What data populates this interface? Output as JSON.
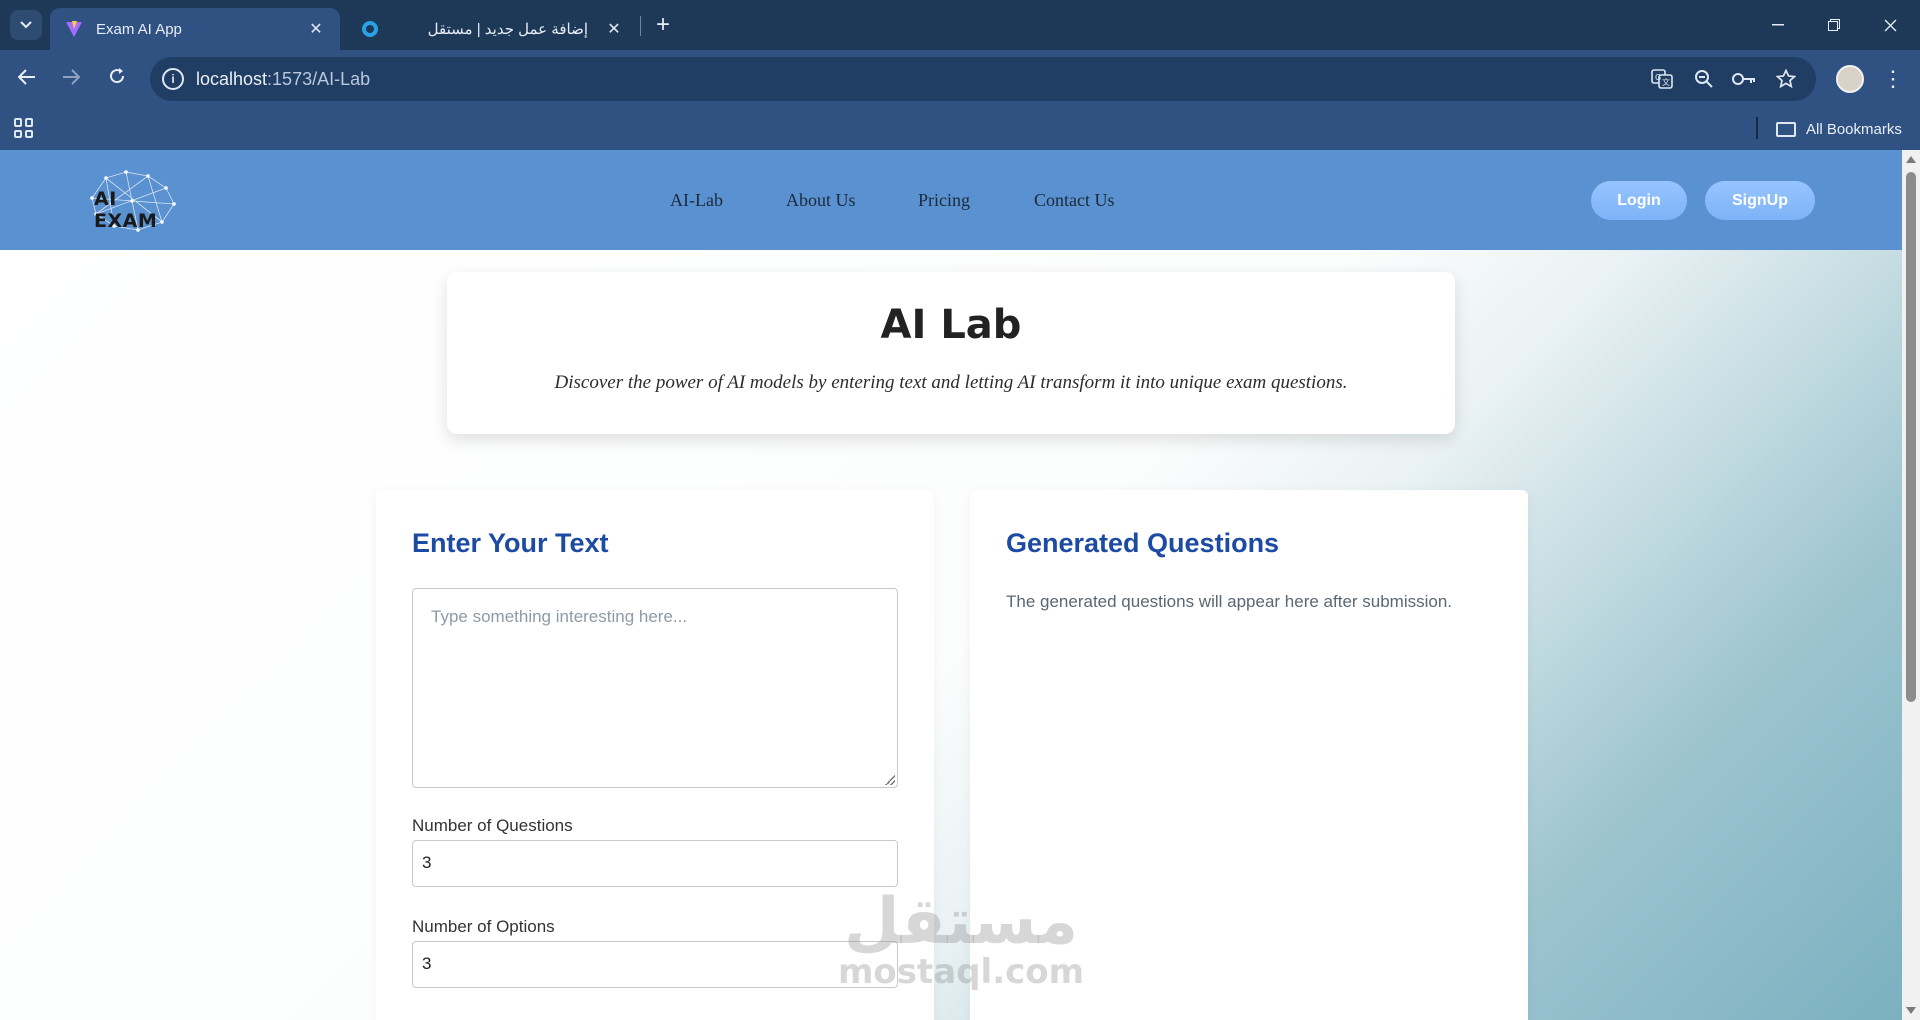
{
  "browser": {
    "tabs": [
      {
        "title": "Exam AI App",
        "active": true
      },
      {
        "title": "إضافة عمل جديد | مستقل",
        "active": false
      }
    ],
    "url": {
      "host": "localhost",
      "path": ":1573/AI-Lab"
    },
    "bookmarks_folder": "All Bookmarks",
    "icons": {
      "tab_search": "chevron-down-icon",
      "back": "arrow-left-icon",
      "forward": "arrow-right-icon",
      "reload": "reload-icon",
      "translate": "translate-icon",
      "zoom": "zoom-out-icon",
      "password": "key-icon",
      "bookmark": "star-icon"
    }
  },
  "site": {
    "logo_text": "AI EXAM",
    "nav": [
      "AI-Lab",
      "About Us",
      "Pricing",
      "Contact Us"
    ],
    "login_label": "Login",
    "signup_label": "SignUp",
    "colors": {
      "header": "#5a91d0",
      "heading_blue": "#1d4aa3",
      "button": "#8bbcfb"
    }
  },
  "hero": {
    "title": "AI Lab",
    "subtitle": "Discover the power of AI models by entering text and letting AI transform it into unique exam questions."
  },
  "input_panel": {
    "heading": "Enter Your Text",
    "textarea_placeholder": "Type something interesting here...",
    "questions_label": "Number of Questions",
    "questions_value": "3",
    "options_label": "Number of Options",
    "options_value": "3"
  },
  "output_panel": {
    "heading": "Generated Questions",
    "placeholder": "The generated questions will appear here after submission."
  },
  "watermark": {
    "arabic": "مستقل",
    "latin": "mostaql.com"
  }
}
